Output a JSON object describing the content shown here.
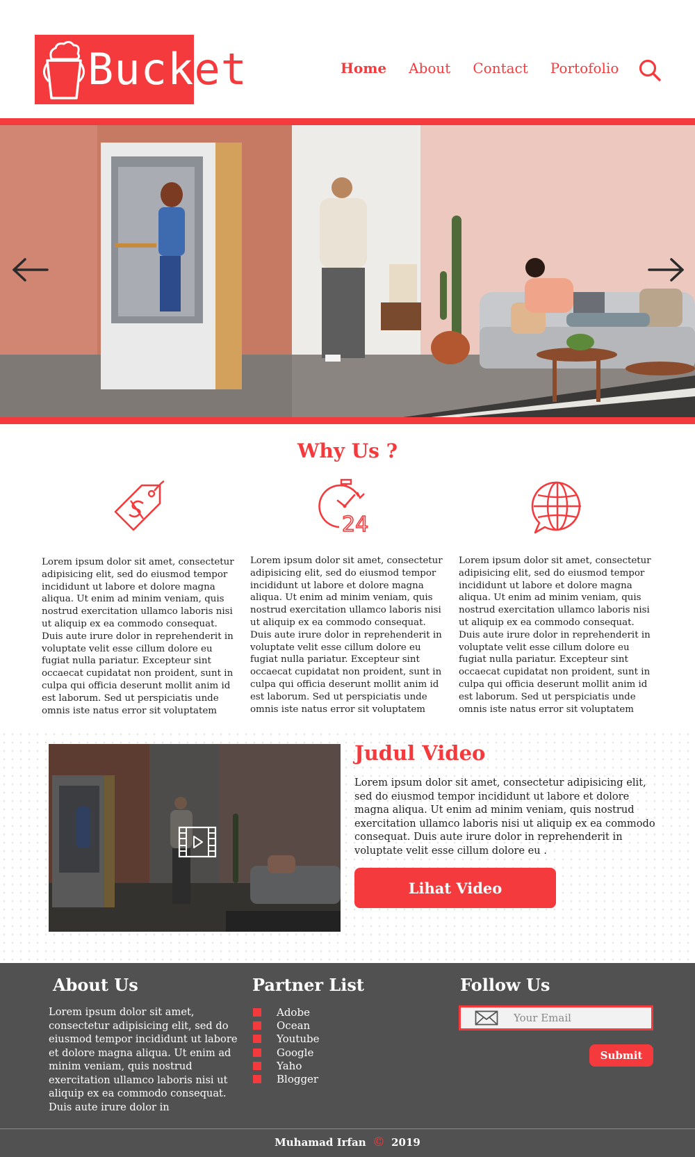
{
  "colors": {
    "accent": "#f43a3c",
    "footer_bg": "#515151"
  },
  "brand": {
    "name_part1": "Buck",
    "name_part2": "et"
  },
  "nav": {
    "items": [
      "Home",
      "About",
      "Contact",
      "Portofolio"
    ],
    "active": "Home"
  },
  "hero": {
    "prev_icon": "arrow-left-icon",
    "next_icon": "arrow-right-icon"
  },
  "why_us": {
    "title": "Why Us ?",
    "features": [
      {
        "icon": "price-tag-icon",
        "text": "Lorem ipsum dolor sit amet, consectetur adipisicing elit, sed do eiusmod tempor incididunt ut labore et dolore magna aliqua. Ut enim ad minim veniam, quis nostrud exercitation ullamco laboris nisi ut aliquip ex ea commodo consequat. Duis aute irure dolor in reprehenderit in voluptate velit esse cillum dolore eu fugiat nulla pariatur. Excepteur sint occaecat cupidatat non proident, sunt in culpa qui officia deserunt mollit anim id est laborum. Sed ut perspiciatis unde omnis iste natus error sit voluptatem"
      },
      {
        "icon": "clock-24-icon",
        "text": "Lorem ipsum dolor sit amet, consectetur adipisicing elit, sed do eiusmod tempor incididunt ut labore et dolore magna aliqua. Ut enim ad minim veniam, quis nostrud exercitation ullamco laboris nisi ut aliquip ex ea commodo consequat. Duis aute irure dolor in reprehenderit in voluptate velit esse cillum dolore eu fugiat nulla pariatur. Excepteur sint occaecat cupidatat non proident, sunt in culpa qui officia deserunt mollit anim id est laborum. Sed ut perspiciatis unde omnis iste natus error sit voluptatem"
      },
      {
        "icon": "globe-chat-icon",
        "text": "Lorem ipsum dolor sit amet, consectetur adipisicing elit, sed do eiusmod tempor incididunt ut labore et dolore magna aliqua. Ut enim ad minim veniam, quis nostrud exercitation ullamco laboris nisi ut aliquip ex ea commodo consequat. Duis aute irure dolor in reprehenderit in voluptate velit esse cillum dolore eu fugiat nulla pariatur. Excepteur sint occaecat cupidatat non proident, sunt in culpa qui officia deserunt mollit anim id est laborum. Sed ut perspiciatis unde omnis iste natus error sit voluptatem"
      }
    ]
  },
  "video": {
    "title": "Judul Video",
    "description": "Lorem ipsum dolor sit amet, consectetur adipisicing elit, sed do eiusmod tempor incididunt ut labore et dolore magna aliqua. Ut enim ad minim veniam, quis nostrud exercitation ullamco laboris nisi ut aliquip ex ea commodo consequat. Duis aute irure dolor in reprehenderit in voluptate velit esse cillum dolore eu .",
    "button_label": "Lihat Video",
    "play_icon": "video-play-icon"
  },
  "footer": {
    "about": {
      "heading": "About Us",
      "text": "Lorem ipsum dolor sit amet, consectetur adipisicing elit, sed do eiusmod tempor incididunt ut labore et dolore magna aliqua. Ut enim ad minim veniam, quis nostrud exercitation ullamco laboris nisi ut aliquip ex ea commodo consequat. Duis aute irure dolor in"
    },
    "partners": {
      "heading": "Partner List",
      "items": [
        "Adobe",
        "Ocean",
        "Youtube",
        "Google",
        "Yaho",
        "Blogger"
      ]
    },
    "follow": {
      "heading": "Follow Us",
      "email_placeholder": "Your Email",
      "submit_label": "Submit"
    },
    "copyright": {
      "name": "Muhamad Irfan",
      "symbol": "©",
      "year": "2019"
    }
  }
}
